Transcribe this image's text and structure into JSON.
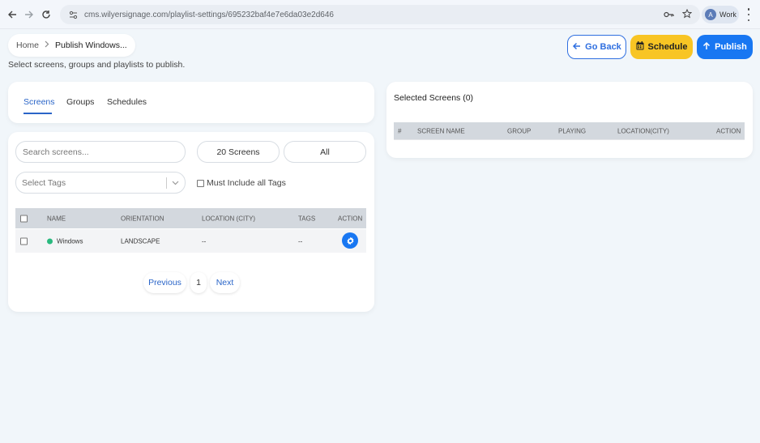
{
  "browser": {
    "url": "cms.wilyersignage.com/playlist-settings/695232baf4e7e6da03e2d646",
    "profile_initial": "A",
    "profile_label": "Work"
  },
  "breadcrumb": {
    "home": "Home",
    "current": "Publish Windows..."
  },
  "subtitle": "Select screens, groups and playlists to publish.",
  "actions": {
    "back": "Go Back",
    "schedule": "Schedule",
    "publish": "Publish"
  },
  "tabs": [
    {
      "label": "Screens",
      "active": true
    },
    {
      "label": "Groups",
      "active": false
    },
    {
      "label": "Schedules",
      "active": false
    }
  ],
  "filters": {
    "search_placeholder": "Search screens...",
    "count": "20 Screens",
    "status": "All",
    "tags_placeholder": "Select Tags",
    "must_include": "Must Include all Tags"
  },
  "screens_table": {
    "headers": [
      "NAME",
      "ORIENTATION",
      "LOCATION (CITY)",
      "TAGS",
      "ACTION"
    ],
    "rows": [
      {
        "name": "Windows",
        "status_color": "#29b97e",
        "orientation": "LANDSCAPE",
        "location": "--",
        "tags": "--"
      }
    ]
  },
  "pagination": {
    "previous": "Previous",
    "page": "1",
    "next": "Next"
  },
  "selected": {
    "title": "Selected Screens (0)",
    "headers": [
      "#",
      "SCREEN NAME",
      "GROUP",
      "PLAYING",
      "LOCATION(CITY)",
      "ACTION"
    ]
  },
  "colors": {
    "primary": "#1877f2",
    "accent": "#f8c524",
    "link": "#2a65c8",
    "online": "#29b97e"
  }
}
